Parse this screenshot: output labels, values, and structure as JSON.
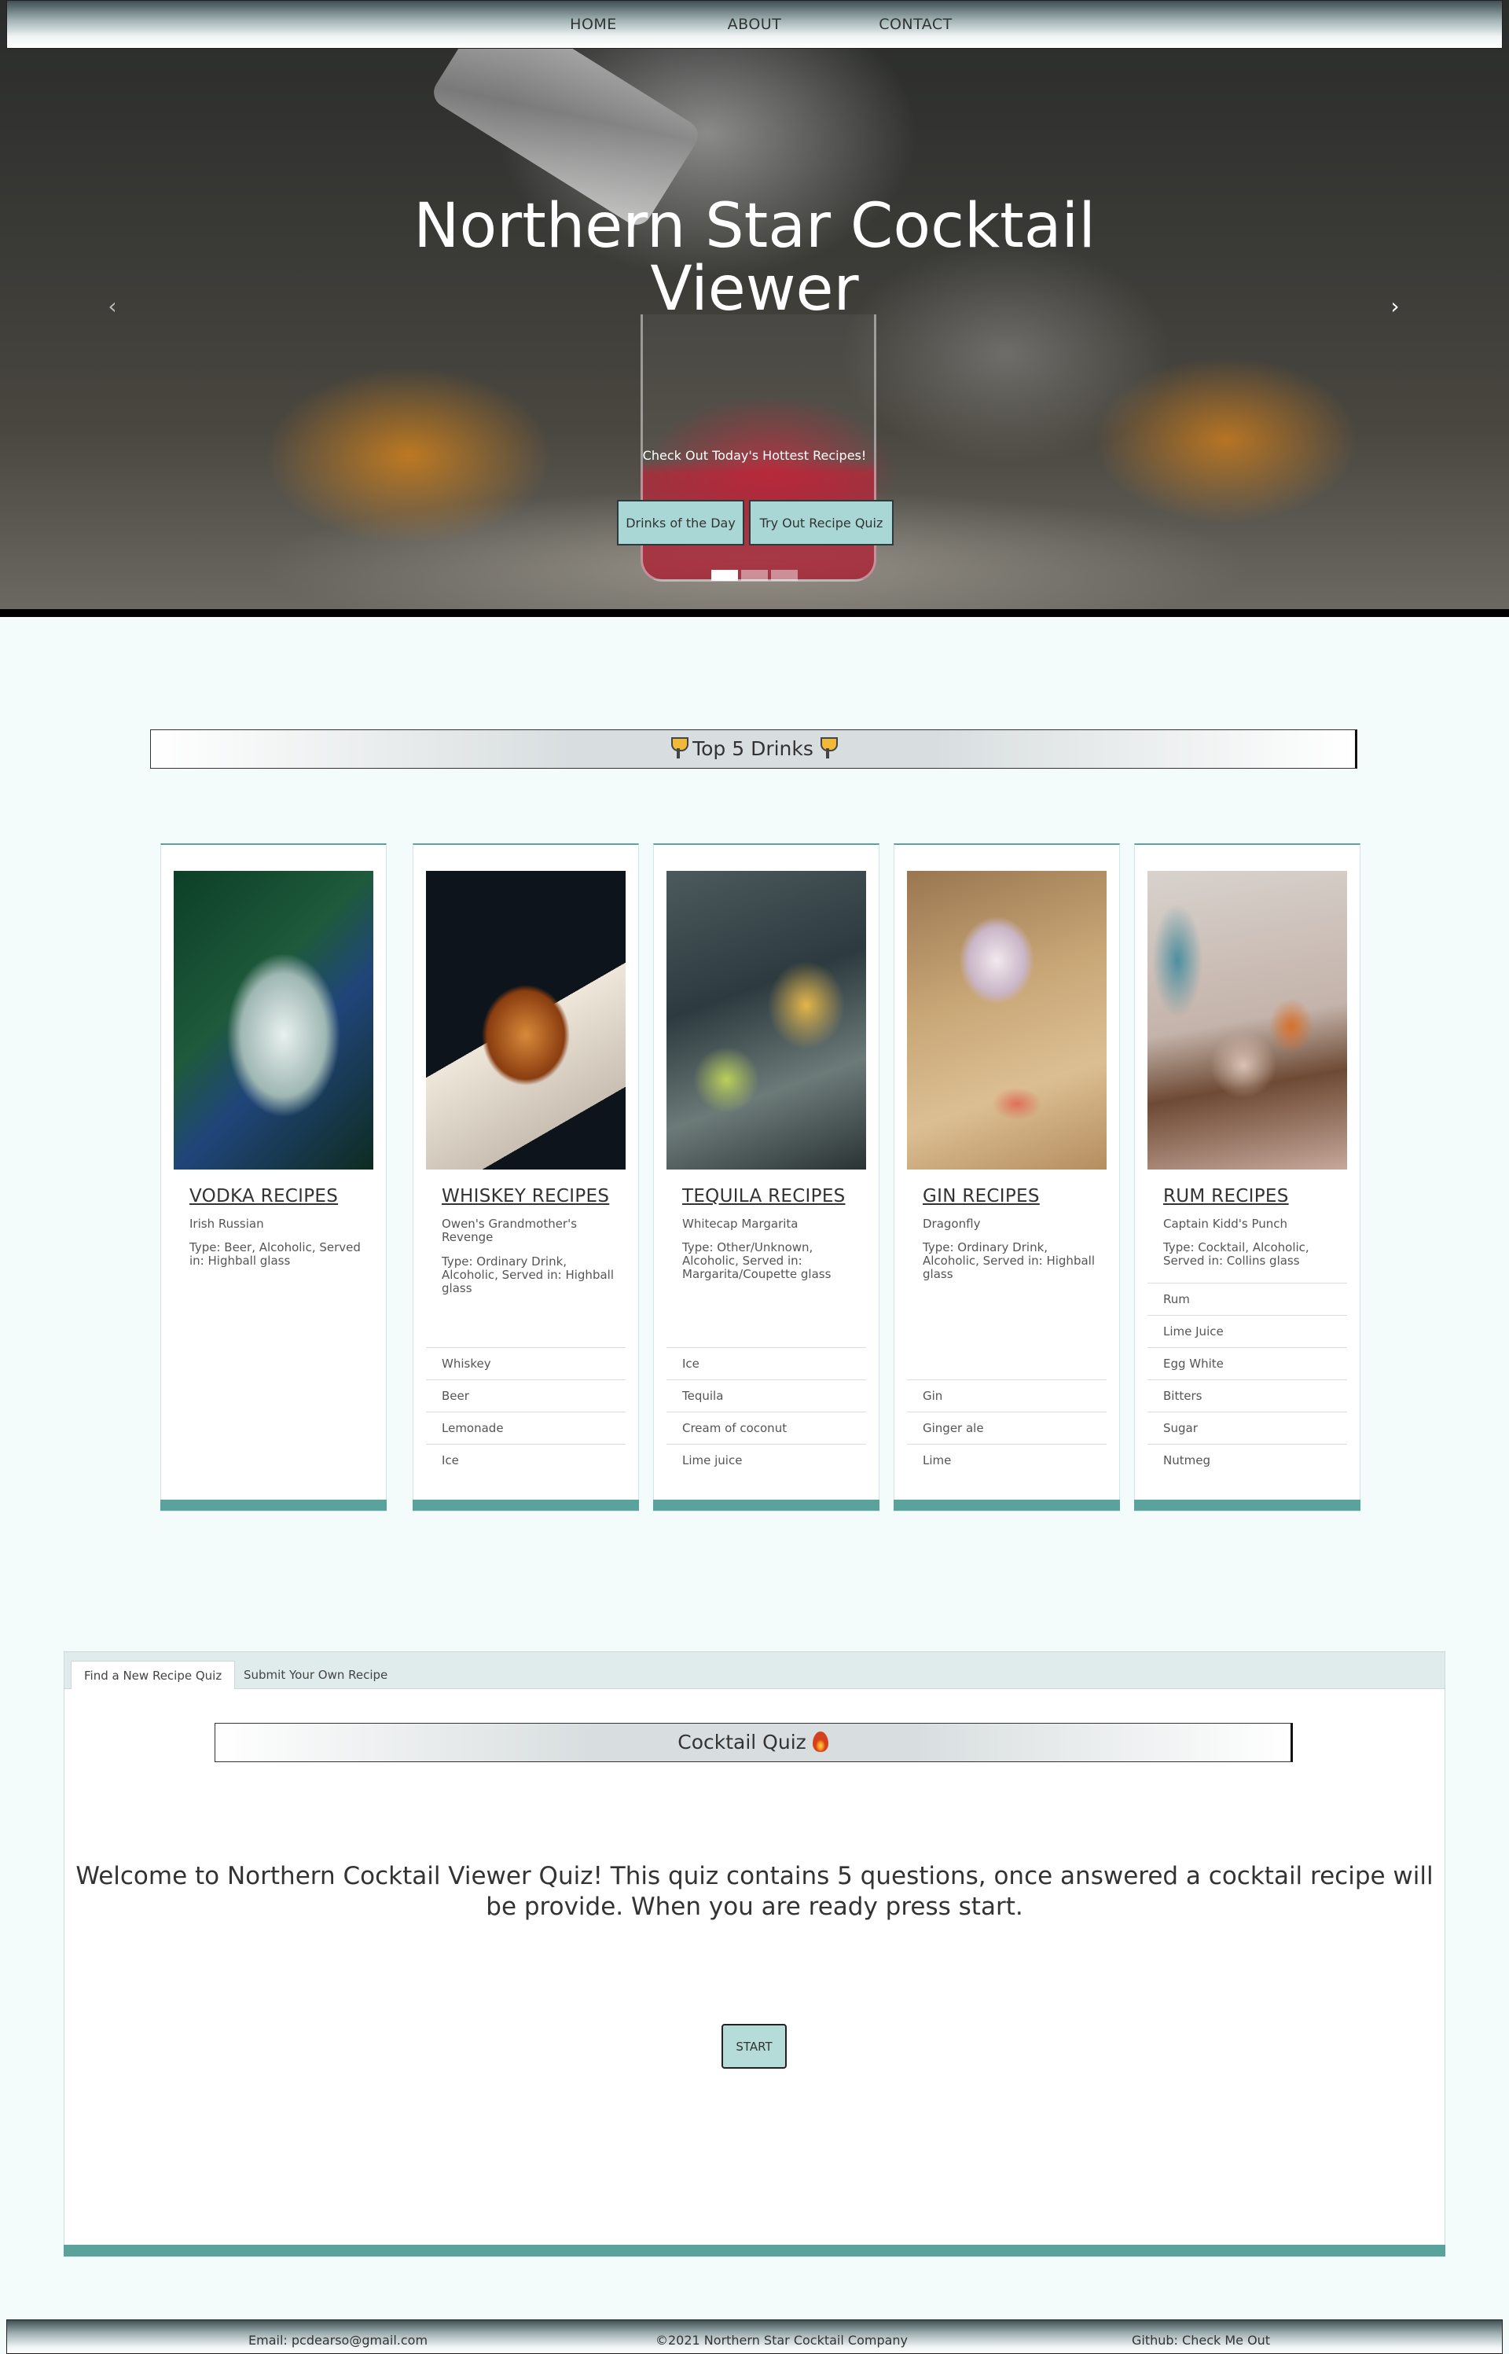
{
  "nav": {
    "items": [
      "HOME",
      "ABOUT",
      "CONTACT"
    ]
  },
  "hero": {
    "title": "Northern Star Cocktail Viewer",
    "subtitle": "Check Out Today's Hottest Recipes!",
    "button_drinks": "Drinks of the Day",
    "button_quiz": "Try Out Recipe Quiz",
    "prev_icon": "chevron-left-icon",
    "next_icon": "chevron-right-icon",
    "slide_count": 3,
    "active_slide": 1
  },
  "top5": {
    "title": "Top 5 Drinks",
    "icon": "cocktail-glass-icon"
  },
  "cards": [
    {
      "name": "VODKA RECIPES",
      "drink": "Irish Russian",
      "type": "Type: Beer, Alcoholic, Served in: Highball glass",
      "ingredients": []
    },
    {
      "name": "WHISKEY RECIPES",
      "drink": "Owen's Grandmother's Revenge",
      "type": "Type: Ordinary Drink, Alcoholic, Served in: Highball glass",
      "ingredients": [
        "Whiskey",
        "Beer",
        "Lemonade",
        "Ice"
      ]
    },
    {
      "name": "TEQUILA RECIPES",
      "drink": "Whitecap Margarita",
      "type": "Type: Other/Unknown, Alcoholic, Served in: Margarita/Coupette glass",
      "ingredients": [
        "Ice",
        "Tequila",
        "Cream of coconut",
        "Lime juice"
      ]
    },
    {
      "name": "GIN RECIPES",
      "drink": "Dragonfly",
      "type": "Type: Ordinary Drink, Alcoholic, Served in: Highball glass",
      "ingredients": [
        "Gin",
        "Ginger ale",
        "Lime"
      ]
    },
    {
      "name": "RUM RECIPES",
      "drink": "Captain Kidd's Punch",
      "type": "Type: Cocktail, Alcoholic, Served in: Collins glass",
      "ingredients": [
        "Rum",
        "Lime Juice",
        "Egg White",
        "Bitters",
        "Sugar",
        "Nutmeg"
      ]
    }
  ],
  "tabs": {
    "active": "Find a New Recipe Quiz",
    "second": "Submit Your Own Recipe"
  },
  "quiz": {
    "title": "Cocktail Quiz",
    "icon": "fire-icon",
    "welcome": "Welcome to Northern Cocktail Viewer Quiz! This quiz contains 5 questions, once answered a cocktail recipe will be provide. When you are ready press start.",
    "start_label": "START"
  },
  "footer": {
    "email": "Email: pcdearso@gmail.com",
    "copyright": "©2021 Northern Star Cocktail Company",
    "github": "Github: Check Me Out"
  },
  "colors": {
    "accent": "#5aa39d",
    "button": "#a9d7d6",
    "page_bg": "#f4fbfb"
  }
}
